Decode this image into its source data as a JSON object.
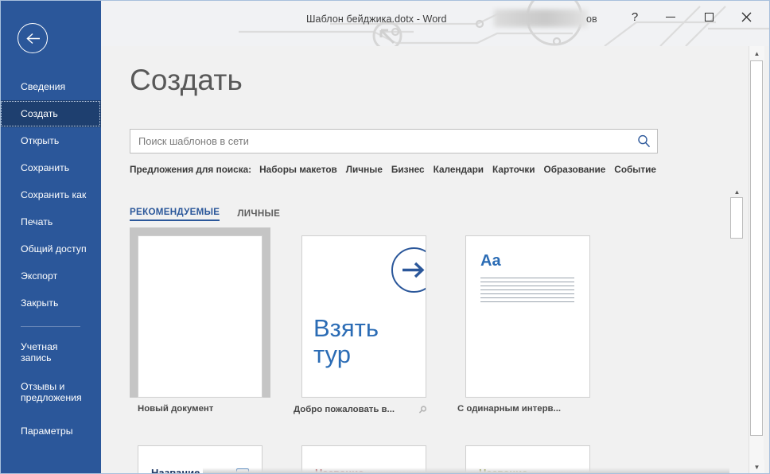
{
  "window": {
    "title": "Шаблон бейджика.dotx  -  Word",
    "user_name_tail": "ов",
    "help_label": "?",
    "minimize_label": "Свернуть",
    "maximize_label": "Развернуть",
    "close_label": "Закрыть"
  },
  "sidebar": {
    "back_label": "Назад",
    "items": [
      {
        "label": "Сведения",
        "active": false
      },
      {
        "label": "Создать",
        "active": true
      },
      {
        "label": "Открыть",
        "active": false
      },
      {
        "label": "Сохранить",
        "active": false
      },
      {
        "label": "Сохранить как",
        "active": false
      },
      {
        "label": "Печать",
        "active": false
      },
      {
        "label": "Общий доступ",
        "active": false
      },
      {
        "label": "Экспорт",
        "active": false
      },
      {
        "label": "Закрыть",
        "active": false
      },
      {
        "label": "Учетная\nзапись",
        "active": false
      },
      {
        "label": "Отзывы и\nпредложения",
        "active": false
      },
      {
        "label": "Параметры",
        "active": false
      }
    ]
  },
  "main": {
    "page_title": "Создать",
    "search": {
      "placeholder": "Поиск шаблонов в сети",
      "value": "",
      "button_label": "Начать поиск"
    },
    "suggestions": {
      "label": "Предложения для поиска:",
      "items": [
        "Наборы макетов",
        "Личные",
        "Бизнес",
        "Календари",
        "Карточки",
        "Образование",
        "Событие"
      ]
    },
    "tabs": [
      {
        "label": "РЕКОМЕНДУЕМЫЕ",
        "active": true
      },
      {
        "label": "ЛИЧНЫЕ",
        "active": false
      }
    ],
    "templates_row1": [
      {
        "caption": "Новый документ",
        "selected": true,
        "art": "blank",
        "pinned": false
      },
      {
        "caption": "Добро пожаловать в...",
        "selected": false,
        "art": "tour",
        "pinned": true,
        "art_text_line1": "Взять",
        "art_text_line2": "тур"
      },
      {
        "caption": "С одинарным интерв...",
        "selected": false,
        "art": "aa",
        "pinned": false,
        "art_text": "Aa"
      }
    ],
    "templates_row2": [
      {
        "art_text": "Название",
        "color": "#1f3864",
        "has_badge": true
      },
      {
        "art_text": "Название",
        "color": "#a3333d",
        "has_badge": false
      },
      {
        "art_text": "Название",
        "color": "#7f8c2a",
        "has_badge": false
      }
    ]
  },
  "scrollbars": {
    "outer_up": "▲",
    "outer_down": "▼",
    "inner_up": "▲"
  },
  "colors": {
    "accent_blue": "#2b579a",
    "rail_active": "#1e3f6f",
    "link_blue": "#2b6cb5",
    "pane_bg": "#f1f1f1"
  }
}
